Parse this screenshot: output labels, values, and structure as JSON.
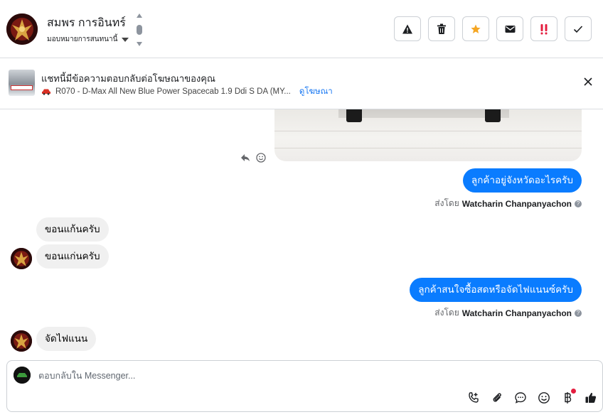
{
  "header": {
    "user_name": "สมพร การอินทร์",
    "assign_label": "มอบหมายการสนทนานี้"
  },
  "actions": [
    {
      "name": "mark-spam-button",
      "icon": "warning-icon"
    },
    {
      "name": "delete-button",
      "icon": "trash-icon"
    },
    {
      "name": "star-button",
      "icon": "star-icon"
    },
    {
      "name": "mark-unread-button",
      "icon": "envelope-icon"
    },
    {
      "name": "follow-up-button",
      "icon": "double-exclamation-icon"
    },
    {
      "name": "mark-done-button",
      "icon": "check-icon"
    }
  ],
  "colors": {
    "accent": "#0a7cff",
    "star": "#f5a623",
    "alert": "#e41e3f",
    "link": "#1877f2"
  },
  "ad_banner": {
    "title": "แชทนี้มีข้อความตอบกลับต่อโฆษณาของคุณ",
    "subtitle": "R070 - D-Max All New Blue Power Spacecab 1.9 Ddi S DA (MY...",
    "link": "ดูโฆษณา"
  },
  "messages": {
    "out1": "ลูกค้าอยู่จังหวัดอะไรครับ",
    "sent_by_prefix": "ส่งโดย",
    "sender": "Watcharin Chanpanyachon",
    "in1": "ขอนแก้นครับ",
    "in2": "ขอนแก่นครับ",
    "out2": "ลูกค้าสนใจซื้อสดหรือจัดไฟแนนซ์ครับ",
    "in3": "จัดไฟแนน"
  },
  "composer": {
    "placeholder": "ตอบกลับใน Messenger..."
  }
}
